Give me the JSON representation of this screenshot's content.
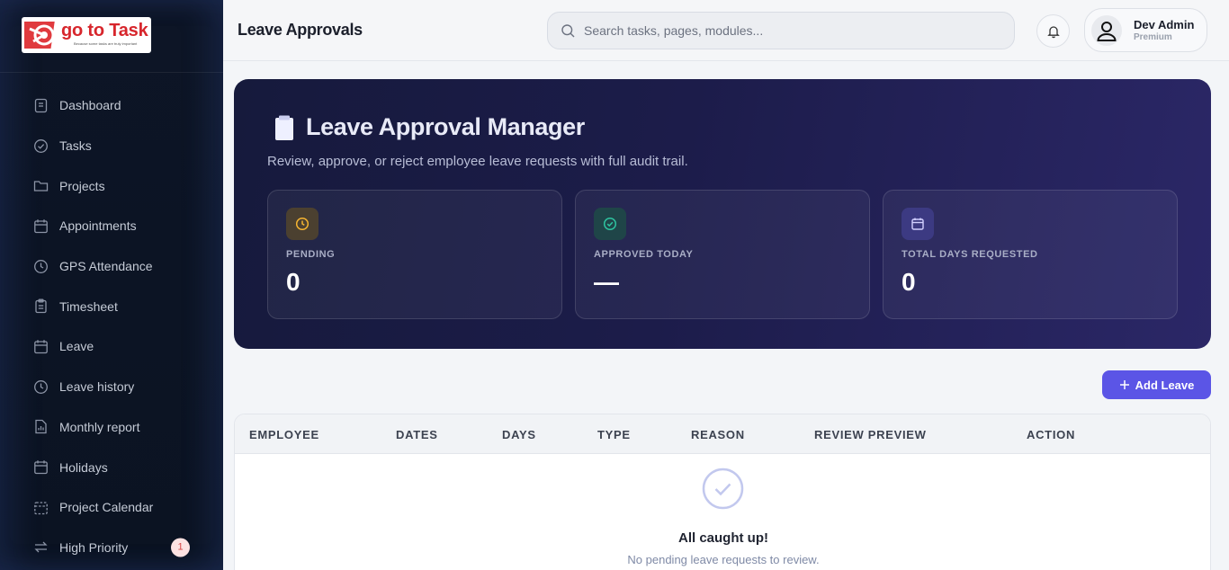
{
  "brand": {
    "name": "go to Task",
    "tagline": "Because some tasks are truly important"
  },
  "sidebar": {
    "items": [
      {
        "label": "Dashboard",
        "icon": "dashboard-icon"
      },
      {
        "label": "Tasks",
        "icon": "check-circle-icon"
      },
      {
        "label": "Projects",
        "icon": "folder-icon"
      },
      {
        "label": "Appointments",
        "icon": "calendar-icon"
      },
      {
        "label": "GPS Attendance",
        "icon": "clock-icon"
      },
      {
        "label": "Timesheet",
        "icon": "clipboard-icon"
      },
      {
        "label": "Leave",
        "icon": "calendar-icon"
      },
      {
        "label": "Leave history",
        "icon": "clock-icon"
      },
      {
        "label": "Monthly report",
        "icon": "report-icon"
      },
      {
        "label": "Holidays",
        "icon": "calendar-icon"
      },
      {
        "label": "Project Calendar",
        "icon": "calendar-dashed-icon"
      },
      {
        "label": "High Priority",
        "icon": "arrows-icon",
        "badge": "1"
      }
    ]
  },
  "header": {
    "title": "Leave Approvals",
    "search_placeholder": "Search tasks, pages, modules...",
    "user_name": "Dev Admin",
    "user_plan": "Premium"
  },
  "hero": {
    "title": "Leave Approval Manager",
    "subtitle": "Review, approve, or reject employee leave requests with full audit trail.",
    "stats": [
      {
        "label": "PENDING",
        "value": "0",
        "icon": "clock-icon",
        "color": "#f5b431"
      },
      {
        "label": "APPROVED TODAY",
        "value": "—",
        "icon": "check-circle-icon",
        "color": "#2ec4a0"
      },
      {
        "label": "TOTAL DAYS REQUESTED",
        "value": "0",
        "icon": "calendar-icon",
        "color": "#b8b6f5"
      }
    ]
  },
  "actions": {
    "add_leave": "Add Leave"
  },
  "table": {
    "columns": [
      "EMPLOYEE",
      "DATES",
      "DAYS",
      "TYPE",
      "REASON",
      "REVIEW PREVIEW",
      "ACTION"
    ],
    "empty_title": "All caught up!",
    "empty_subtitle": "No pending leave requests to review."
  },
  "colors": {
    "accent": "#5b55e6",
    "sidebar_bg": "#0d1526",
    "hero_bg": "#1c1c4a"
  }
}
